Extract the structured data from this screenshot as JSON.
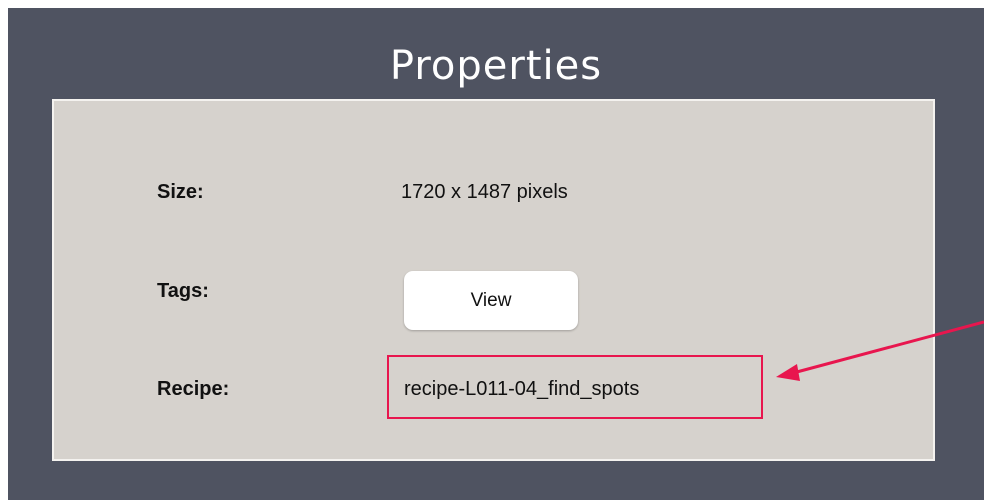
{
  "dialog": {
    "title": "Properties"
  },
  "properties": {
    "size_label": "Size:",
    "size_value": "1720 x 1487 pixels",
    "tags_label": "Tags:",
    "tags_button_label": "View",
    "recipe_label": "Recipe:",
    "recipe_value": "recipe-L011-04_find_spots"
  },
  "annotation": {
    "highlight_color": "#e8164e"
  },
  "colors": {
    "background": "#4f5361",
    "panel": "#d6d2cd",
    "title_text": "#ffffff"
  }
}
